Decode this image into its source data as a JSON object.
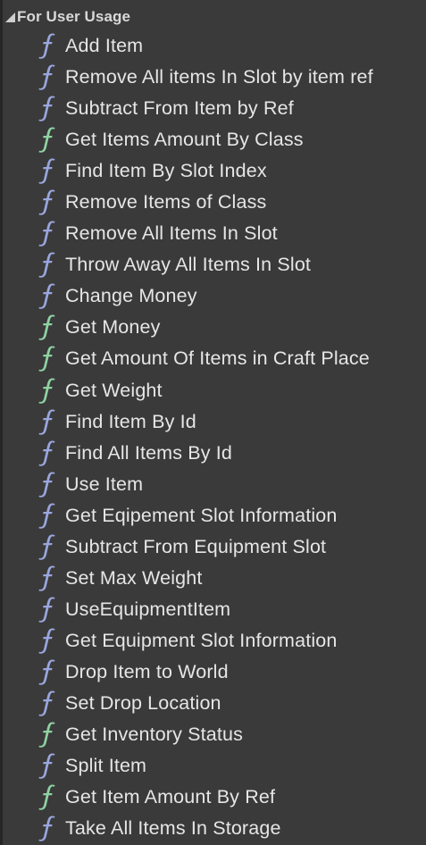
{
  "category": {
    "label": "For User Usage",
    "expanded": true,
    "arrow_icon": "collapse-triangle-icon"
  },
  "icon_colors": {
    "blue": "#9aa6de",
    "green": "#8fd3a3"
  },
  "functions": [
    {
      "label": "Add Item",
      "icon": "function-icon",
      "color": "blue"
    },
    {
      "label": "Remove All items In Slot by item ref",
      "icon": "function-icon",
      "color": "blue"
    },
    {
      "label": "Subtract From Item by Ref",
      "icon": "function-icon",
      "color": "blue"
    },
    {
      "label": "Get Items Amount By Class",
      "icon": "pure-function-icon",
      "color": "green"
    },
    {
      "label": "Find Item By Slot Index",
      "icon": "function-icon",
      "color": "blue"
    },
    {
      "label": "Remove Items of Class",
      "icon": "function-icon",
      "color": "blue"
    },
    {
      "label": "Remove All Items In Slot",
      "icon": "function-icon",
      "color": "blue"
    },
    {
      "label": "Throw Away All Items In Slot",
      "icon": "function-icon",
      "color": "blue"
    },
    {
      "label": "Change Money",
      "icon": "function-icon",
      "color": "blue"
    },
    {
      "label": "Get Money",
      "icon": "pure-function-icon",
      "color": "green"
    },
    {
      "label": "Get Amount Of Items in Craft Place",
      "icon": "pure-function-icon",
      "color": "green"
    },
    {
      "label": "Get Weight",
      "icon": "pure-function-icon",
      "color": "green"
    },
    {
      "label": "Find Item By Id",
      "icon": "function-icon",
      "color": "blue"
    },
    {
      "label": "Find All Items By Id",
      "icon": "function-icon",
      "color": "blue"
    },
    {
      "label": "Use Item",
      "icon": "function-icon",
      "color": "blue"
    },
    {
      "label": "Get Eqipement Slot Information",
      "icon": "function-icon",
      "color": "blue"
    },
    {
      "label": "Subtract From Equipment Slot",
      "icon": "function-icon",
      "color": "blue"
    },
    {
      "label": "Set Max Weight",
      "icon": "function-icon",
      "color": "blue"
    },
    {
      "label": "UseEquipmentItem",
      "icon": "function-icon",
      "color": "blue"
    },
    {
      "label": "Get Equipment Slot Information",
      "icon": "function-icon",
      "color": "blue"
    },
    {
      "label": "Drop Item to World",
      "icon": "function-icon",
      "color": "blue"
    },
    {
      "label": "Set Drop Location",
      "icon": "function-icon",
      "color": "blue"
    },
    {
      "label": "Get Inventory Status",
      "icon": "pure-function-icon",
      "color": "green"
    },
    {
      "label": "Split Item",
      "icon": "function-icon",
      "color": "blue"
    },
    {
      "label": "Get Item Amount By Ref",
      "icon": "pure-function-icon",
      "color": "green"
    },
    {
      "label": "Take All Items In Storage",
      "icon": "function-icon",
      "color": "blue"
    }
  ]
}
